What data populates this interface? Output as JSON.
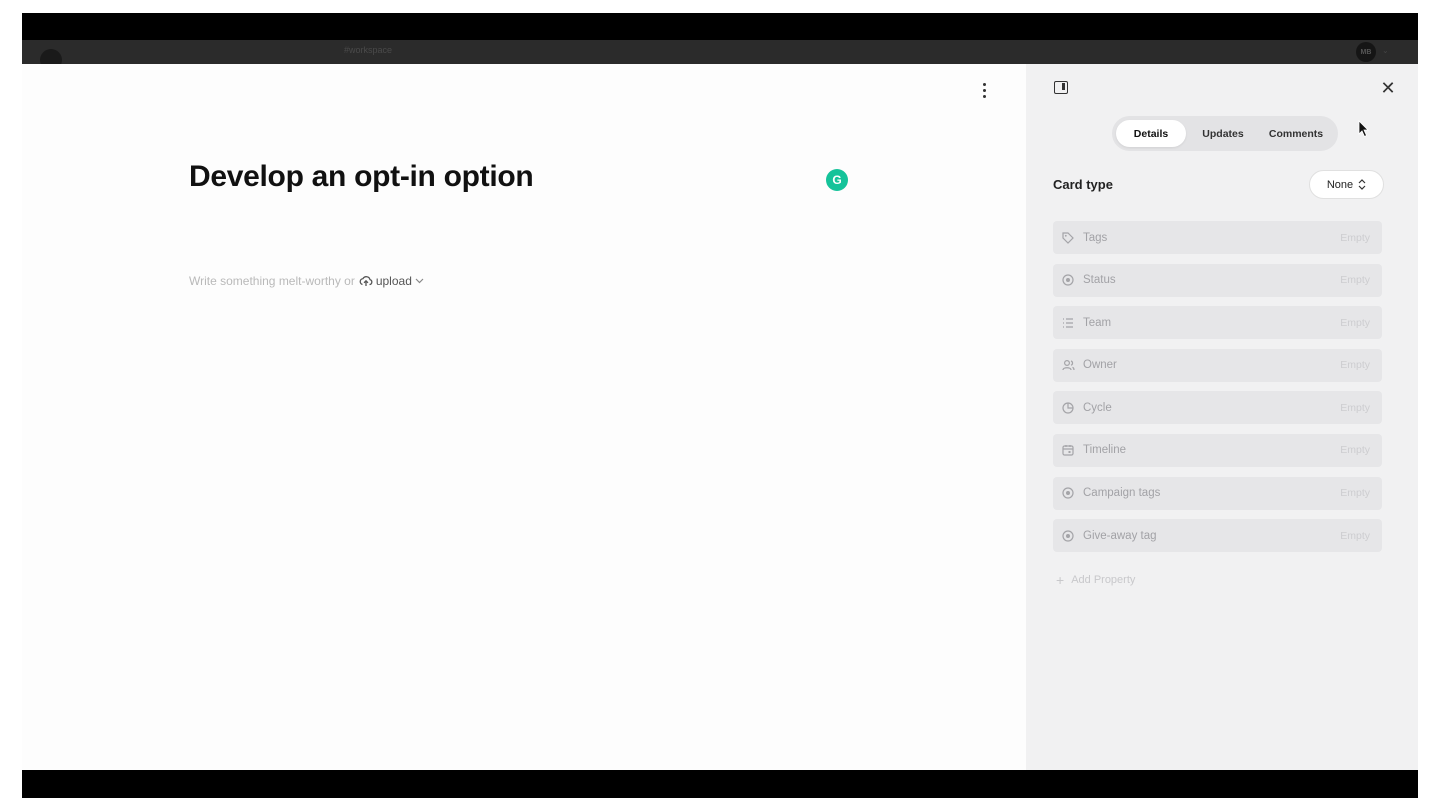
{
  "app_header": {
    "workspace": "#workspace",
    "avatar_initials": "MB"
  },
  "editor": {
    "title": "Develop an opt-in option",
    "placeholder": "Write something melt-worthy or",
    "upload_label": "upload",
    "grammarly_letter": "G"
  },
  "panel": {
    "tabs": [
      {
        "label": "Details",
        "active": true
      },
      {
        "label": "Updates",
        "active": false
      },
      {
        "label": "Comments",
        "active": false
      }
    ],
    "card_type": {
      "label": "Card type",
      "value": "None"
    },
    "properties": [
      {
        "label": "Tags",
        "value": "Empty",
        "icon": "tag-icon"
      },
      {
        "label": "Status",
        "value": "Empty",
        "icon": "status-icon"
      },
      {
        "label": "Team",
        "value": "Empty",
        "icon": "list-icon"
      },
      {
        "label": "Owner",
        "value": "Empty",
        "icon": "users-icon"
      },
      {
        "label": "Cycle",
        "value": "Empty",
        "icon": "cycle-icon"
      },
      {
        "label": "Timeline",
        "value": "Empty",
        "icon": "calendar-icon"
      },
      {
        "label": "Campaign tags",
        "value": "Empty",
        "icon": "status-icon"
      },
      {
        "label": "Give-away tag",
        "value": "Empty",
        "icon": "status-icon"
      }
    ],
    "add_property": "Add Property"
  }
}
